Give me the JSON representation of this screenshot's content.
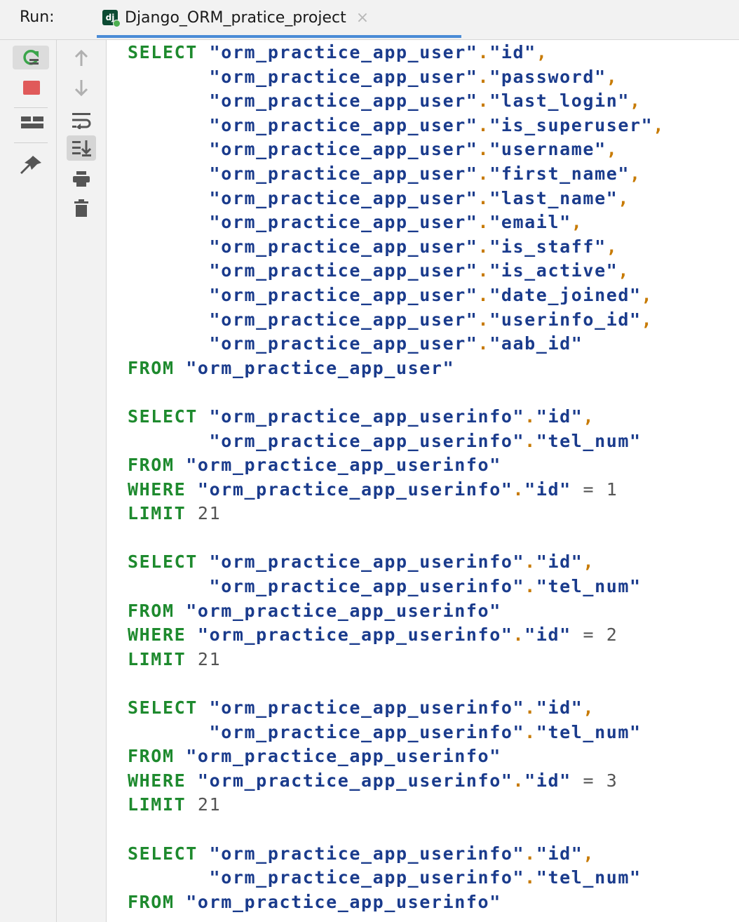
{
  "header": {
    "run_label": "Run:",
    "tab_title": "Django_ORM_pratice_project",
    "tab_icon_text": "dj",
    "tab_close": "×"
  },
  "toolbar": {
    "left": [
      "rerun-icon",
      "stop-icon",
      "layout-icon",
      "pin-icon"
    ],
    "right": [
      "arrow-up-icon",
      "arrow-down-icon",
      "soft-wrap-icon",
      "scroll-to-end-icon",
      "print-icon",
      "trash-icon"
    ]
  },
  "colors": {
    "keyword": "#1e8a2e",
    "string": "#1a3b8c",
    "punct": "#c77a00",
    "number": "#555555",
    "stop": "#e05a5a"
  },
  "code_lines": [
    "SELECT \"orm_practice_app_user\".\"id\",",
    "       \"orm_practice_app_user\".\"password\",",
    "       \"orm_practice_app_user\".\"last_login\",",
    "       \"orm_practice_app_user\".\"is_superuser\",",
    "       \"orm_practice_app_user\".\"username\",",
    "       \"orm_practice_app_user\".\"first_name\",",
    "       \"orm_practice_app_user\".\"last_name\",",
    "       \"orm_practice_app_user\".\"email\",",
    "       \"orm_practice_app_user\".\"is_staff\",",
    "       \"orm_practice_app_user\".\"is_active\",",
    "       \"orm_practice_app_user\".\"date_joined\",",
    "       \"orm_practice_app_user\".\"userinfo_id\",",
    "       \"orm_practice_app_user\".\"aab_id\"",
    "FROM \"orm_practice_app_user\"",
    "",
    "SELECT \"orm_practice_app_userinfo\".\"id\",",
    "       \"orm_practice_app_userinfo\".\"tel_num\"",
    "FROM \"orm_practice_app_userinfo\"",
    "WHERE \"orm_practice_app_userinfo\".\"id\" = 1",
    "LIMIT 21",
    "",
    "SELECT \"orm_practice_app_userinfo\".\"id\",",
    "       \"orm_practice_app_userinfo\".\"tel_num\"",
    "FROM \"orm_practice_app_userinfo\"",
    "WHERE \"orm_practice_app_userinfo\".\"id\" = 2",
    "LIMIT 21",
    "",
    "SELECT \"orm_practice_app_userinfo\".\"id\",",
    "       \"orm_practice_app_userinfo\".\"tel_num\"",
    "FROM \"orm_practice_app_userinfo\"",
    "WHERE \"orm_practice_app_userinfo\".\"id\" = 3",
    "LIMIT 21",
    "",
    "SELECT \"orm_practice_app_userinfo\".\"id\",",
    "       \"orm_practice_app_userinfo\".\"tel_num\"",
    "FROM \"orm_practice_app_userinfo\""
  ]
}
